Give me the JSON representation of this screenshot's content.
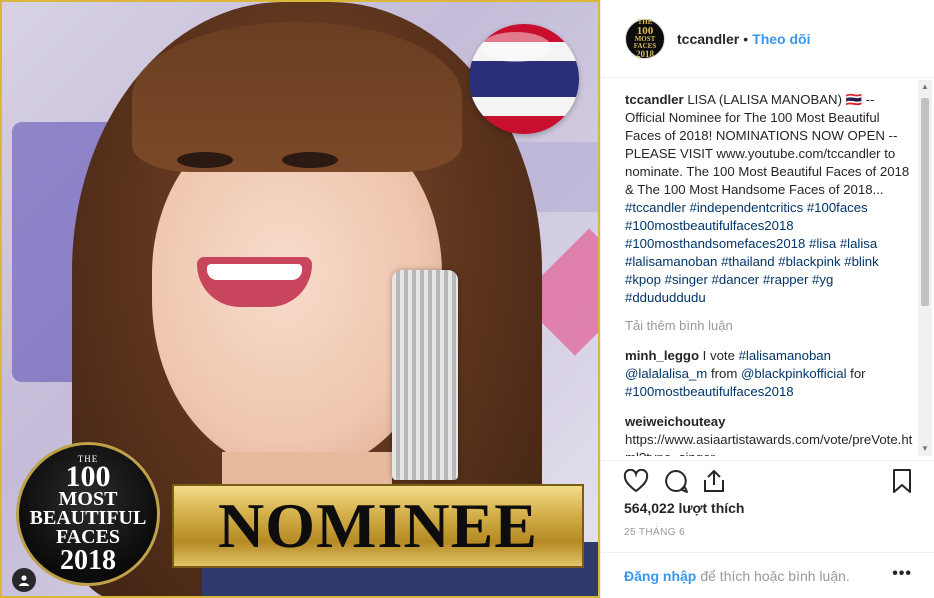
{
  "post": {
    "nominee_label": "NOMINEE",
    "badge": {
      "the": "THE",
      "num": "100",
      "most": "MOST",
      "beautiful": "BEAUTIFUL",
      "faces": "FACES",
      "year": "2018"
    },
    "flag_icon": "thailand-flag-icon"
  },
  "header": {
    "avatar_text": [
      "THE",
      "100",
      "MOST",
      "FACES",
      "2018"
    ],
    "username": "tccandler",
    "separator": "•",
    "follow_label": "Theo dõi"
  },
  "caption": {
    "username": "tccandler",
    "text": "LISA (LALISA MANOBAN) 🇹🇭 -- Official Nominee for The 100 Most Beautiful Faces of 2018! NOMINATIONS NOW OPEN -- PLEASE VISIT www.youtube.com/tccandler to nominate. The 100 Most Beautiful Faces of 2018 & The 100 Most Handsome Faces of 2018...",
    "hashtags": [
      "#tccandler",
      "#independentcritics",
      "#100faces",
      "#100mostbeautifulfaces2018",
      "#100mosthandsomefaces2018",
      "#lisa",
      "#lalisa",
      "#lalisamanoban",
      "#thailand",
      "#blackpink",
      "#blink",
      "#kpop",
      "#singer",
      "#dancer",
      "#rapper",
      "#yg",
      "#ddududdudu"
    ]
  },
  "load_more_label": "Tải thêm bình luận",
  "comments": [
    {
      "user": "minh_leggo",
      "pre": "I vote ",
      "tag1": "#lalisamanoban",
      "mention": "@lalalalisa_m",
      "mid": " from ",
      "mention2": "@blackpinkofficial",
      "post": " for ",
      "tag2": "#100mostbeautifulfaces2018"
    },
    {
      "user": "weiweichouteay",
      "text": "https://www.asiaartistawards.com/vote/preVote.html?type=singer"
    }
  ],
  "actions": {
    "like_icon": "heart-icon",
    "comment_icon": "comment-bubble-icon",
    "share_icon": "share-icon",
    "save_icon": "bookmark-icon"
  },
  "likes_text": "564,022 lượt thích",
  "date_text": "25 THÁNG 6",
  "footer": {
    "login_label": "Đăng nhập",
    "rest_text": "để thích hoặc bình luận.",
    "more_label": "•••"
  },
  "colors": {
    "accent_blue": "#3897f0",
    "hashtag_blue": "#003569",
    "badge_gold": "#d4b04a"
  }
}
